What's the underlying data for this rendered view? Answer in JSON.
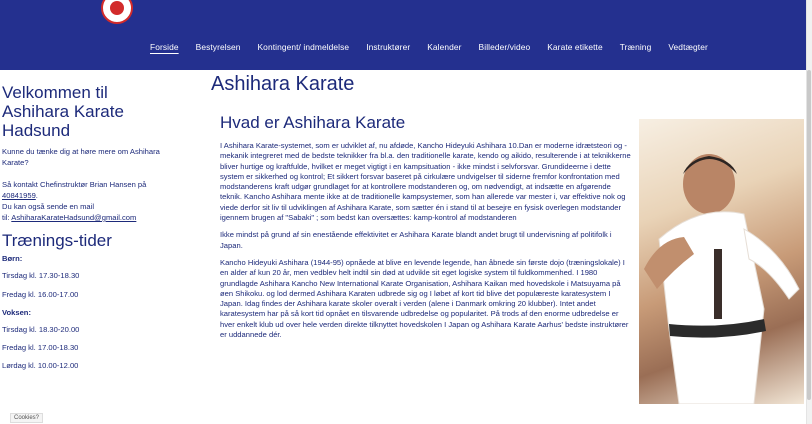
{
  "nav": {
    "items": [
      {
        "label": "Forside",
        "active": true
      },
      {
        "label": "Bestyrelsen"
      },
      {
        "label": "Kontingent/ indmeldelse"
      },
      {
        "label": "Instruktører"
      },
      {
        "label": "Kalender"
      },
      {
        "label": "Billeder/video"
      },
      {
        "label": "Karate etikette"
      },
      {
        "label": "Træning"
      },
      {
        "label": "Vedtægter"
      }
    ]
  },
  "sidebar": {
    "welcome_title": "Velkommen til Ashihara Karate Hadsund",
    "intro": "Kunne du tænke dig at høre mere om Ashihara Karate?",
    "contact_line": "Så kontakt Chefinstruktør Brian Hansen på",
    "phone": "40841959",
    "phone_suffix": ".",
    "email_line": "Du kan også sende en mail",
    "email_prefix": "til: ",
    "email": "AshiharaKarateHadsund@gmail.com",
    "training_title": "Trænings-tider",
    "children_label": "Børn:",
    "children_times": [
      "Tirsdag kl. 17.30-18.30",
      "Fredag kl. 16.00-17.00"
    ],
    "adults_label": "Voksen:",
    "adults_times": [
      "Tirsdag kl. 18.30-20.00",
      "Fredag kl. 17.00-18.30",
      "Lørdag kl. 10.00-12.00"
    ]
  },
  "main": {
    "title": "Ashihara Karate",
    "section_title": "Hvad er Ashihara Karate",
    "paragraphs": [
      "I Ashihara Karate-systemet, som er udviklet af, nu afdøde, Kancho Hideyuki Ashihara 10.Dan er moderne idrætsteori og -mekanik integreret med de bedste teknikker fra bl.a. den traditionelle karate, kendo og aikido, resulterende i at teknikkerne bliver hurtige og kraftfulde, hvilket er meget vigtigt i en kampsituation - ikke mindst i selvforsvar. Grundideerne i dette system er sikkerhed og kontrol; Et sikkert forsvar baseret på cirkulære undvigelser til siderne fremfor konfrontation med modstanderens kraft udgør grundlaget for at kontrollere modstanderen og, om nødvendigt, at indsætte en afgørende teknik. Kancho Ashihara mente ikke at de traditionelle kampsystemer, som han allerede var mester i, var effektive nok og viede derfor sit liv til udviklingen af Ashihara Karate, som sætter én i stand til at besejre en fysisk overlegen modstander igennem brugen af \"Sabaki\" ; som bedst kan oversættes: kamp-kontrol af modstanderen",
      "Ikke mindst på grund af sin enestående effektivitet er Ashihara Karate blandt andet brugt til undervisning af politifolk i Japan.",
      "Kancho Hideyuki Ashihara (1944-95) opnåede at blive en levende legende, han åbnede sin første dojo (træningslokale) I en alder af kun 20 år, men vedblev helt indtil sin død at udvikle sit eget logiske system til fuldkommenhed. I 1980 grundlagde Ashihara Kancho New International Karate Organisation, Ashihara Kaikan med hovedskole i Matsuyama på øen Shikoku. og lod dermed Ashihara Karaten udbrede sig og I løbet af kort tid blive det populæreste karatesystem I Japan. Idag findes der Ashihara karate skoler overalt i verden (alene i Danmark omkring 20 klubber). Intet andet karatesystem har på så kort tid opnået en tilsvarende udbredelse og popularitet. På trods af den enorme udbredelse er hver enkelt klub ud over hele verden direkte tilknyttet hovedskolen I Japan og Ashihara Karate Aarhus' bedste instruktører er uddannede dér."
    ]
  },
  "cookies_label": "Cookies?",
  "colors": {
    "header": "#24308f",
    "text": "#1d2a7a",
    "logo_accent": "#d22b2b"
  },
  "icons": {
    "logo": "club-logo-icon"
  }
}
